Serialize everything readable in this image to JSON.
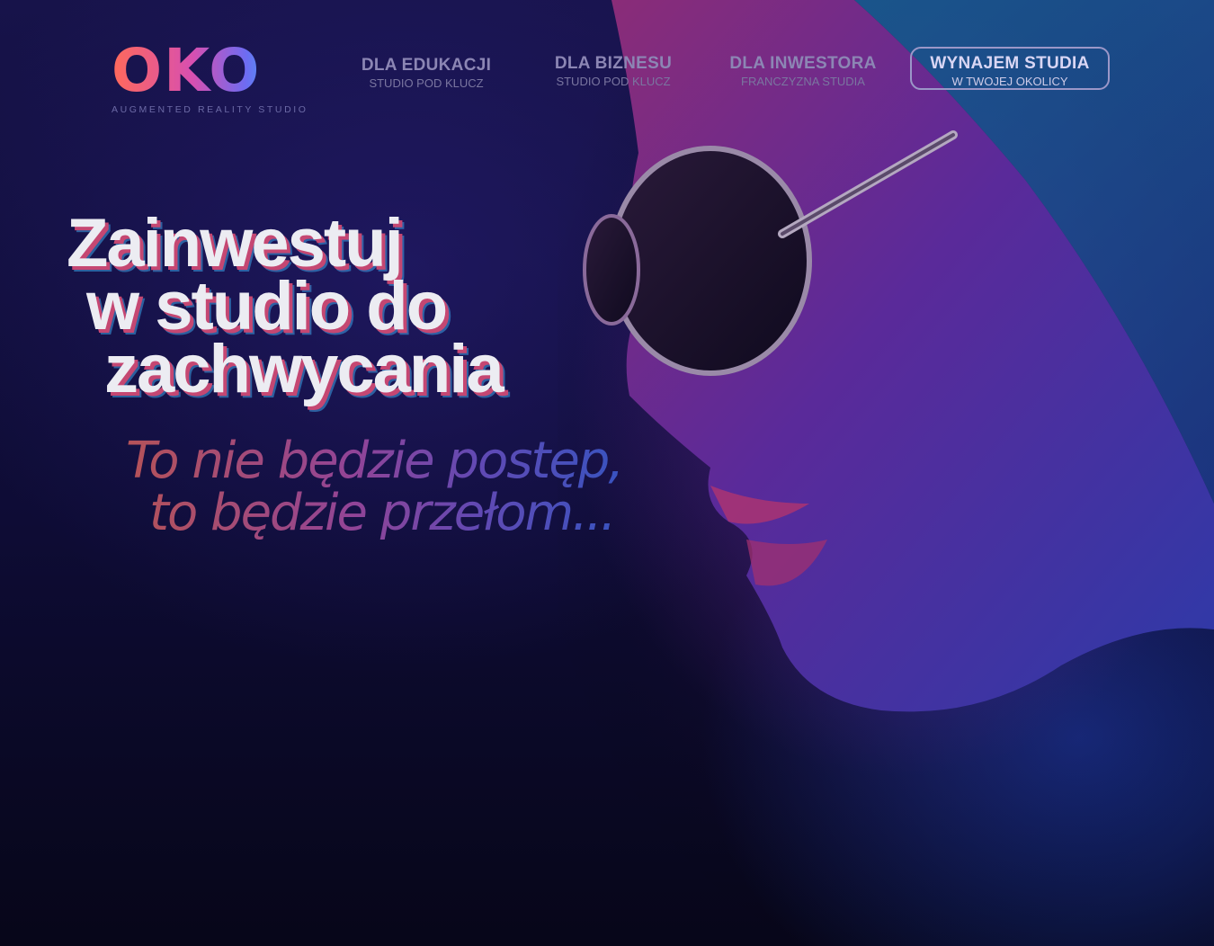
{
  "brand": {
    "logo_text": "OKO",
    "tagline": "AUGMENTED REALITY STUDIO"
  },
  "nav": {
    "items": [
      {
        "title": "DLA EDUKACJI",
        "subtitle": "STUDIO POD KLUCZ"
      },
      {
        "title": "DLA BIZNESU",
        "subtitle": "STUDIO POD KLUCZ"
      },
      {
        "title": "DLA INWESTORA",
        "subtitle": "FRANCZYZNA STUDIA"
      },
      {
        "title": "WYNAJEM STUDIA",
        "subtitle": "W TWOJEJ OKOLICY"
      }
    ]
  },
  "hero": {
    "headline": [
      "Zainwestuj",
      "w studio do",
      "zachwycania"
    ],
    "subline": [
      "To nie będzie postęp,",
      "to będzie przełom..."
    ]
  },
  "colors": {
    "background": "#0e0c35",
    "logo_gradient": [
      "#ff6a5a",
      "#d84fb0",
      "#6d6cf2",
      "#2fc3f0"
    ],
    "headline_shadow": "#c54772"
  },
  "icons": {
    "hero_image": "woman-with-sunglasses-profile"
  }
}
